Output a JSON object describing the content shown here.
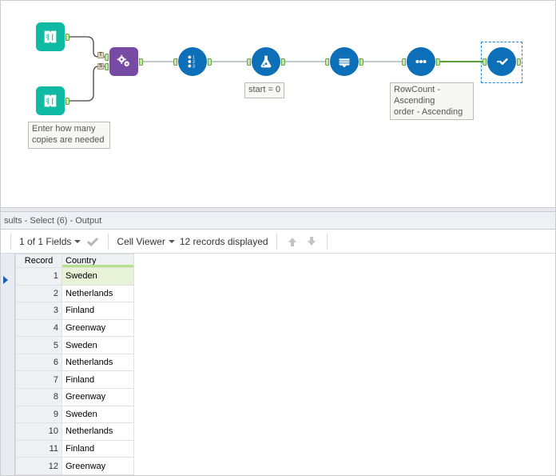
{
  "canvas": {
    "textinput1_caption": "Enter how many\ncopies are needed",
    "formula_caption": "start = 0",
    "sort_caption": "RowCount -\nAscending\norder - Ascending"
  },
  "results": {
    "header": "sults - Select (6) - Output",
    "toolbar": {
      "fields": "1 of 1 Fields",
      "cell_viewer": "Cell Viewer",
      "records": "12 records displayed"
    }
  },
  "grid": {
    "col_record": "Record",
    "col_country": "Country",
    "rows": [
      {
        "n": "1",
        "country": "Sweden"
      },
      {
        "n": "2",
        "country": "Netherlands"
      },
      {
        "n": "3",
        "country": "Finland"
      },
      {
        "n": "4",
        "country": "Greenway"
      },
      {
        "n": "5",
        "country": "Sweden"
      },
      {
        "n": "6",
        "country": "Netherlands"
      },
      {
        "n": "7",
        "country": "Finland"
      },
      {
        "n": "8",
        "country": "Greenway"
      },
      {
        "n": "9",
        "country": "Sweden"
      },
      {
        "n": "10",
        "country": "Netherlands"
      },
      {
        "n": "11",
        "country": "Finland"
      },
      {
        "n": "12",
        "country": "Greenway"
      }
    ]
  }
}
